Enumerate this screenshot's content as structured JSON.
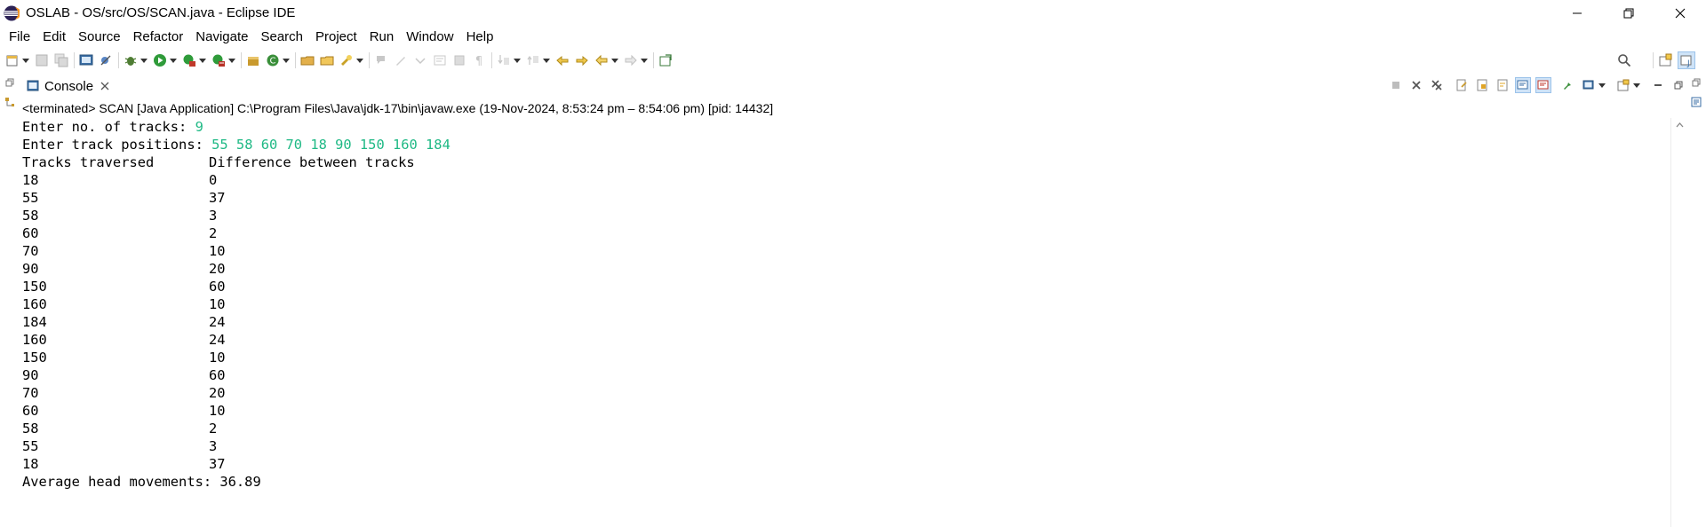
{
  "window": {
    "title": "OSLAB - OS/src/OS/SCAN.java - Eclipse IDE",
    "logo_icon": "eclipse-logo-icon",
    "controls": [
      "minimize-icon",
      "restore-icon",
      "close-icon"
    ]
  },
  "menu": [
    "File",
    "Edit",
    "Source",
    "Refactor",
    "Navigate",
    "Search",
    "Project",
    "Run",
    "Window",
    "Help"
  ],
  "console": {
    "tab_label": "Console",
    "status": "<terminated> SCAN [Java Application] C:\\Program Files\\Java\\jdk-17\\bin\\javaw.exe  (19-Nov-2024, 8:53:24 pm – 8:54:06 pm) [pid: 14432]",
    "prompt_tracks": "Enter no. of tracks: ",
    "input_tracks": "9",
    "prompt_positions": "Enter track positions: ",
    "input_positions": "55 58 60 70 18 90 150 160 184",
    "header_col1": "Tracks traversed",
    "header_col2": "Difference between tracks",
    "rows": [
      [
        "18",
        "0"
      ],
      [
        "55",
        "37"
      ],
      [
        "58",
        "3"
      ],
      [
        "60",
        "2"
      ],
      [
        "70",
        "10"
      ],
      [
        "90",
        "20"
      ],
      [
        "150",
        "60"
      ],
      [
        "160",
        "10"
      ],
      [
        "184",
        "24"
      ],
      [
        "160",
        "24"
      ],
      [
        "150",
        "10"
      ],
      [
        "90",
        "60"
      ],
      [
        "70",
        "20"
      ],
      [
        "60",
        "10"
      ],
      [
        "58",
        "2"
      ],
      [
        "55",
        "3"
      ],
      [
        "18",
        "37"
      ]
    ],
    "average": "Average head movements: 36.89"
  },
  "colors": {
    "stdin_green": "#1fb985",
    "active_toggle_bg": "#cfe3f7"
  }
}
